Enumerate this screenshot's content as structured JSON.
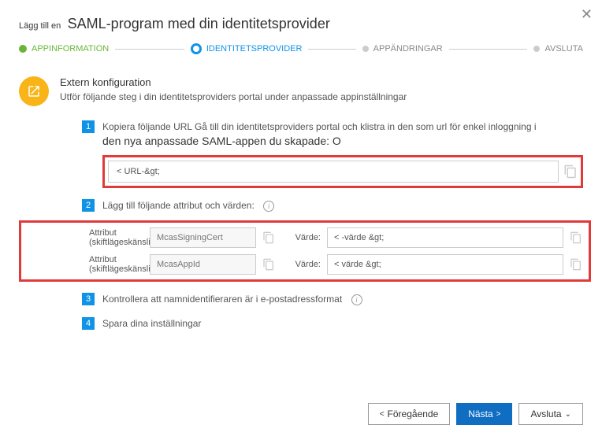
{
  "close_label": "✕",
  "header": {
    "prefix": "Lägg till en",
    "title": "SAML-program med din identitetsprovider"
  },
  "stepper": {
    "s1": "APPINFORMATION",
    "s2": "IDENTITETSPROVIDER",
    "s3": "APPÄNDRINGAR",
    "s4": "AVSLUTA"
  },
  "section": {
    "title": "Extern konfiguration",
    "subtitle": "Utför följande steg i din identitetsproviders portal under anpassade appinställningar"
  },
  "step1": {
    "num": "1",
    "line1": "Kopiera följande URL Gå till din identitetsproviders portal och klistra in den som url för enkel inloggning i",
    "line2": "den nya anpassade SAML-appen du skapade: O",
    "url": "< URL-&gt;"
  },
  "step2": {
    "num": "2",
    "text": "Lägg till följande attribut och värden:",
    "attr_label": "Attribut (skiftlägeskänsligt):",
    "val_label": "Värde:",
    "r1_attr": "McasSigningCert",
    "r1_val": "< -värde &gt;",
    "r2_attr": "McasAppId",
    "r2_val": "< värde &gt;"
  },
  "step3": {
    "num": "3",
    "text": "Kontrollera att namnidentifieraren är i e-postadressformat"
  },
  "step4": {
    "num": "4",
    "text": "Spara dina inställningar"
  },
  "footer": {
    "prev": "Föregående",
    "next": "Nästa",
    "finish": "Avsluta"
  }
}
